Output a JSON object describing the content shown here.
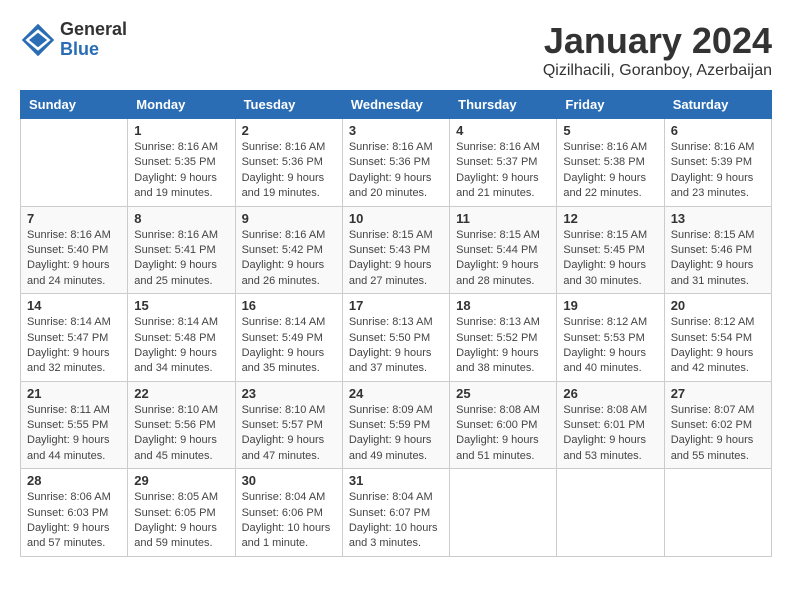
{
  "logo": {
    "general": "General",
    "blue": "Blue"
  },
  "title": "January 2024",
  "location": "Qizilhacili, Goranboy, Azerbaijan",
  "days_of_week": [
    "Sunday",
    "Monday",
    "Tuesday",
    "Wednesday",
    "Thursday",
    "Friday",
    "Saturday"
  ],
  "weeks": [
    [
      {
        "day": "",
        "details": ""
      },
      {
        "day": "1",
        "details": "Sunrise: 8:16 AM\nSunset: 5:35 PM\nDaylight: 9 hours\nand 19 minutes."
      },
      {
        "day": "2",
        "details": "Sunrise: 8:16 AM\nSunset: 5:36 PM\nDaylight: 9 hours\nand 19 minutes."
      },
      {
        "day": "3",
        "details": "Sunrise: 8:16 AM\nSunset: 5:36 PM\nDaylight: 9 hours\nand 20 minutes."
      },
      {
        "day": "4",
        "details": "Sunrise: 8:16 AM\nSunset: 5:37 PM\nDaylight: 9 hours\nand 21 minutes."
      },
      {
        "day": "5",
        "details": "Sunrise: 8:16 AM\nSunset: 5:38 PM\nDaylight: 9 hours\nand 22 minutes."
      },
      {
        "day": "6",
        "details": "Sunrise: 8:16 AM\nSunset: 5:39 PM\nDaylight: 9 hours\nand 23 minutes."
      }
    ],
    [
      {
        "day": "7",
        "details": "Sunrise: 8:16 AM\nSunset: 5:40 PM\nDaylight: 9 hours\nand 24 minutes."
      },
      {
        "day": "8",
        "details": "Sunrise: 8:16 AM\nSunset: 5:41 PM\nDaylight: 9 hours\nand 25 minutes."
      },
      {
        "day": "9",
        "details": "Sunrise: 8:16 AM\nSunset: 5:42 PM\nDaylight: 9 hours\nand 26 minutes."
      },
      {
        "day": "10",
        "details": "Sunrise: 8:15 AM\nSunset: 5:43 PM\nDaylight: 9 hours\nand 27 minutes."
      },
      {
        "day": "11",
        "details": "Sunrise: 8:15 AM\nSunset: 5:44 PM\nDaylight: 9 hours\nand 28 minutes."
      },
      {
        "day": "12",
        "details": "Sunrise: 8:15 AM\nSunset: 5:45 PM\nDaylight: 9 hours\nand 30 minutes."
      },
      {
        "day": "13",
        "details": "Sunrise: 8:15 AM\nSunset: 5:46 PM\nDaylight: 9 hours\nand 31 minutes."
      }
    ],
    [
      {
        "day": "14",
        "details": "Sunrise: 8:14 AM\nSunset: 5:47 PM\nDaylight: 9 hours\nand 32 minutes."
      },
      {
        "day": "15",
        "details": "Sunrise: 8:14 AM\nSunset: 5:48 PM\nDaylight: 9 hours\nand 34 minutes."
      },
      {
        "day": "16",
        "details": "Sunrise: 8:14 AM\nSunset: 5:49 PM\nDaylight: 9 hours\nand 35 minutes."
      },
      {
        "day": "17",
        "details": "Sunrise: 8:13 AM\nSunset: 5:50 PM\nDaylight: 9 hours\nand 37 minutes."
      },
      {
        "day": "18",
        "details": "Sunrise: 8:13 AM\nSunset: 5:52 PM\nDaylight: 9 hours\nand 38 minutes."
      },
      {
        "day": "19",
        "details": "Sunrise: 8:12 AM\nSunset: 5:53 PM\nDaylight: 9 hours\nand 40 minutes."
      },
      {
        "day": "20",
        "details": "Sunrise: 8:12 AM\nSunset: 5:54 PM\nDaylight: 9 hours\nand 42 minutes."
      }
    ],
    [
      {
        "day": "21",
        "details": "Sunrise: 8:11 AM\nSunset: 5:55 PM\nDaylight: 9 hours\nand 44 minutes."
      },
      {
        "day": "22",
        "details": "Sunrise: 8:10 AM\nSunset: 5:56 PM\nDaylight: 9 hours\nand 45 minutes."
      },
      {
        "day": "23",
        "details": "Sunrise: 8:10 AM\nSunset: 5:57 PM\nDaylight: 9 hours\nand 47 minutes."
      },
      {
        "day": "24",
        "details": "Sunrise: 8:09 AM\nSunset: 5:59 PM\nDaylight: 9 hours\nand 49 minutes."
      },
      {
        "day": "25",
        "details": "Sunrise: 8:08 AM\nSunset: 6:00 PM\nDaylight: 9 hours\nand 51 minutes."
      },
      {
        "day": "26",
        "details": "Sunrise: 8:08 AM\nSunset: 6:01 PM\nDaylight: 9 hours\nand 53 minutes."
      },
      {
        "day": "27",
        "details": "Sunrise: 8:07 AM\nSunset: 6:02 PM\nDaylight: 9 hours\nand 55 minutes."
      }
    ],
    [
      {
        "day": "28",
        "details": "Sunrise: 8:06 AM\nSunset: 6:03 PM\nDaylight: 9 hours\nand 57 minutes."
      },
      {
        "day": "29",
        "details": "Sunrise: 8:05 AM\nSunset: 6:05 PM\nDaylight: 9 hours\nand 59 minutes."
      },
      {
        "day": "30",
        "details": "Sunrise: 8:04 AM\nSunset: 6:06 PM\nDaylight: 10 hours\nand 1 minute."
      },
      {
        "day": "31",
        "details": "Sunrise: 8:04 AM\nSunset: 6:07 PM\nDaylight: 10 hours\nand 3 minutes."
      },
      {
        "day": "",
        "details": ""
      },
      {
        "day": "",
        "details": ""
      },
      {
        "day": "",
        "details": ""
      }
    ]
  ]
}
